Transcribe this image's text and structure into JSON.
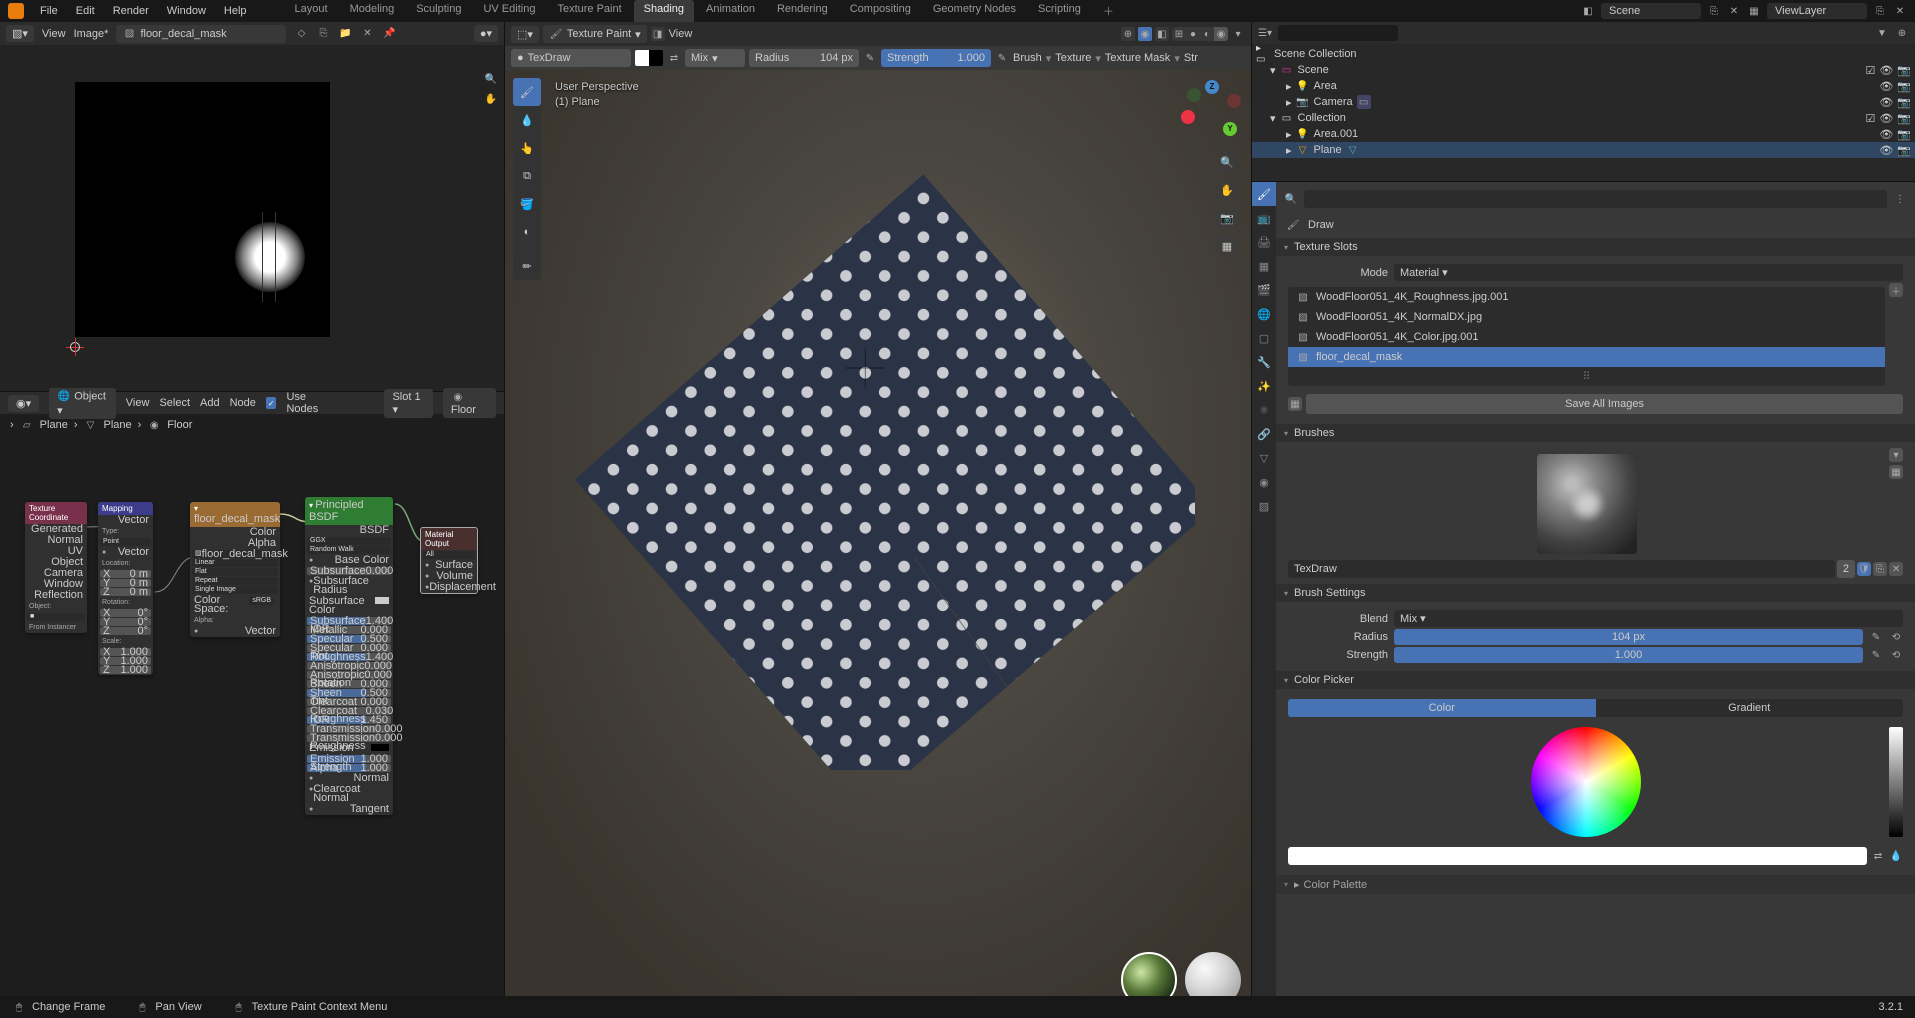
{
  "app": {
    "version": "3.2.1"
  },
  "topmenu": {
    "file": "File",
    "edit": "Edit",
    "render": "Render",
    "window": "Window",
    "help": "Help"
  },
  "workspaces": {
    "layout": "Layout",
    "modeling": "Modeling",
    "sculpting": "Sculpting",
    "uv": "UV Editing",
    "texpaint": "Texture Paint",
    "shading": "Shading",
    "animation": "Animation",
    "rendering": "Rendering",
    "compositing": "Compositing",
    "geonodes": "Geometry Nodes",
    "scripting": "Scripting"
  },
  "top_right": {
    "scene": "Scene",
    "viewlayer": "ViewLayer"
  },
  "image_editor": {
    "menu_view": "View",
    "menu_image": "Image*",
    "image_name": "floor_decal_mask"
  },
  "node_editor": {
    "header": {
      "objmode": "Object",
      "view": "View",
      "select": "Select",
      "add": "Add",
      "node": "Node",
      "usenodes": "Use Nodes",
      "slot": "Slot 1",
      "material": "Floor"
    },
    "breadcrumb": {
      "plane1": "Plane",
      "plane2": "Plane",
      "floor": "Floor"
    },
    "nodes": {
      "texcoord": {
        "title": "Texture Coordinate",
        "outs": [
          "Generated",
          "Normal",
          "UV",
          "Object",
          "Camera",
          "Window",
          "Reflection"
        ],
        "obj_lbl": "Object:",
        "inst": "From Instancer"
      },
      "mapping": {
        "title": "Mapping",
        "vector": "Vector",
        "type": "Type:",
        "point": "Point",
        "loc": "Location:",
        "rot": "Rotation:",
        "scale": "Scale:",
        "xyz": [
          "X",
          "Y",
          "Z"
        ],
        "zeros": "0 m",
        "deg": "0°",
        "one": "1.000"
      },
      "imgtex": {
        "title": "floor_decal_mask",
        "color": "Color",
        "alpha": "Alpha",
        "img": "floor_decal_mask",
        "linear": "Linear",
        "flat": "Flat",
        "repeat": "Repeat",
        "single": "Single Image",
        "cspace": "Color Space:",
        "srgb": "sRGB",
        "alphamode": "Alpha:",
        "vector": "Vector"
      },
      "bsdf": {
        "title": "Principled BSDF",
        "bsdf": "BSDF",
        "ggx": "GGX",
        "randwalk": "Random Walk",
        "basecolor": "Base Color",
        "subsurf": "Subsurface",
        "subsurfrad": "Subsurface Radius",
        "subsurfcol": "Subsurface Color",
        "subsurfior": "Subsurface IOR",
        "metallic": "Metallic",
        "specular": "Specular",
        "spectint": "Specular Tint",
        "roughness": "Roughness",
        "aniso": "Anisotropic",
        "anisorot": "Anisotropic Rotation",
        "sheen": "Sheen",
        "sheentint": "Sheen Tint",
        "clearcoat": "Clearcoat",
        "ccrough": "Clearcoat Roughness",
        "ior": "IOR",
        "transmission": "Transmission",
        "transrough": "Transmission Roughness",
        "emission": "Emission",
        "emitstr": "Emission Strength",
        "alpha": "Alpha",
        "normal": "Normal",
        "ccnormal": "Clearcoat Normal",
        "tangent": "Tangent",
        "vals": {
          "subsurf": "0.000",
          "metallic": "0.000",
          "specular": "0.500",
          "spectint": "0.000",
          "roughness": "1.400",
          "aniso": "0.000",
          "anisorot": "0.000",
          "sheen": "0.000",
          "sheentint": "0.500",
          "clearcoat": "0.000",
          "ccrough": "0.030",
          "ior": "1.450",
          "transmission": "0.000",
          "transrough": "0.000",
          "emitstr": "1.000",
          "alpha": "1.000",
          "subsurfior": "1.400"
        }
      },
      "output": {
        "title": "Material Output",
        "all": "All",
        "surface": "Surface",
        "volume": "Volume",
        "disp": "Displacement"
      }
    }
  },
  "viewport": {
    "mode": "Texture Paint",
    "view": "View",
    "overlay_l1": "User Perspective",
    "overlay_l2": "(1) Plane",
    "brush_settings": {
      "brush": "TexDraw",
      "mix": "Mix",
      "radius_lbl": "Radius",
      "radius": "104 px",
      "strength_lbl": "Strength",
      "strength": "1.000",
      "brush_m": "Brush",
      "texture_m": "Texture",
      "texmask": "Texture Mask",
      "stroke": "Str"
    }
  },
  "outliner": {
    "search_ph": "",
    "items": {
      "scene_coll": "Scene Collection",
      "scene": "Scene",
      "area": "Area",
      "camera": "Camera",
      "collection": "Collection",
      "area001": "Area.001",
      "plane": "Plane"
    }
  },
  "properties": {
    "draw_lbl": "Draw",
    "texslots": {
      "title": "Texture Slots",
      "mode_lbl": "Mode",
      "mode": "Material",
      "list": [
        "WoodFloor051_4K_Roughness.jpg.001",
        "WoodFloor051_4K_NormalDX.jpg",
        "WoodFloor051_4K_Color.jpg.001",
        "floor_decal_mask"
      ],
      "save": "Save All Images"
    },
    "brushes": {
      "title": "Brushes",
      "name": "TexDraw",
      "users": "2"
    },
    "brush_settings": {
      "title": "Brush Settings",
      "blend_lbl": "Blend",
      "blend": "Mix",
      "radius_lbl": "Radius",
      "radius": "104 px",
      "strength_lbl": "Strength",
      "strength": "1.000"
    },
    "colorpicker": {
      "title": "Color Picker",
      "color": "Color",
      "gradient": "Gradient"
    },
    "palette": {
      "title": "Color Palette"
    }
  },
  "statusbar": {
    "changeframe": "Change Frame",
    "panview": "Pan View",
    "ctxmenu": "Texture Paint Context Menu"
  }
}
